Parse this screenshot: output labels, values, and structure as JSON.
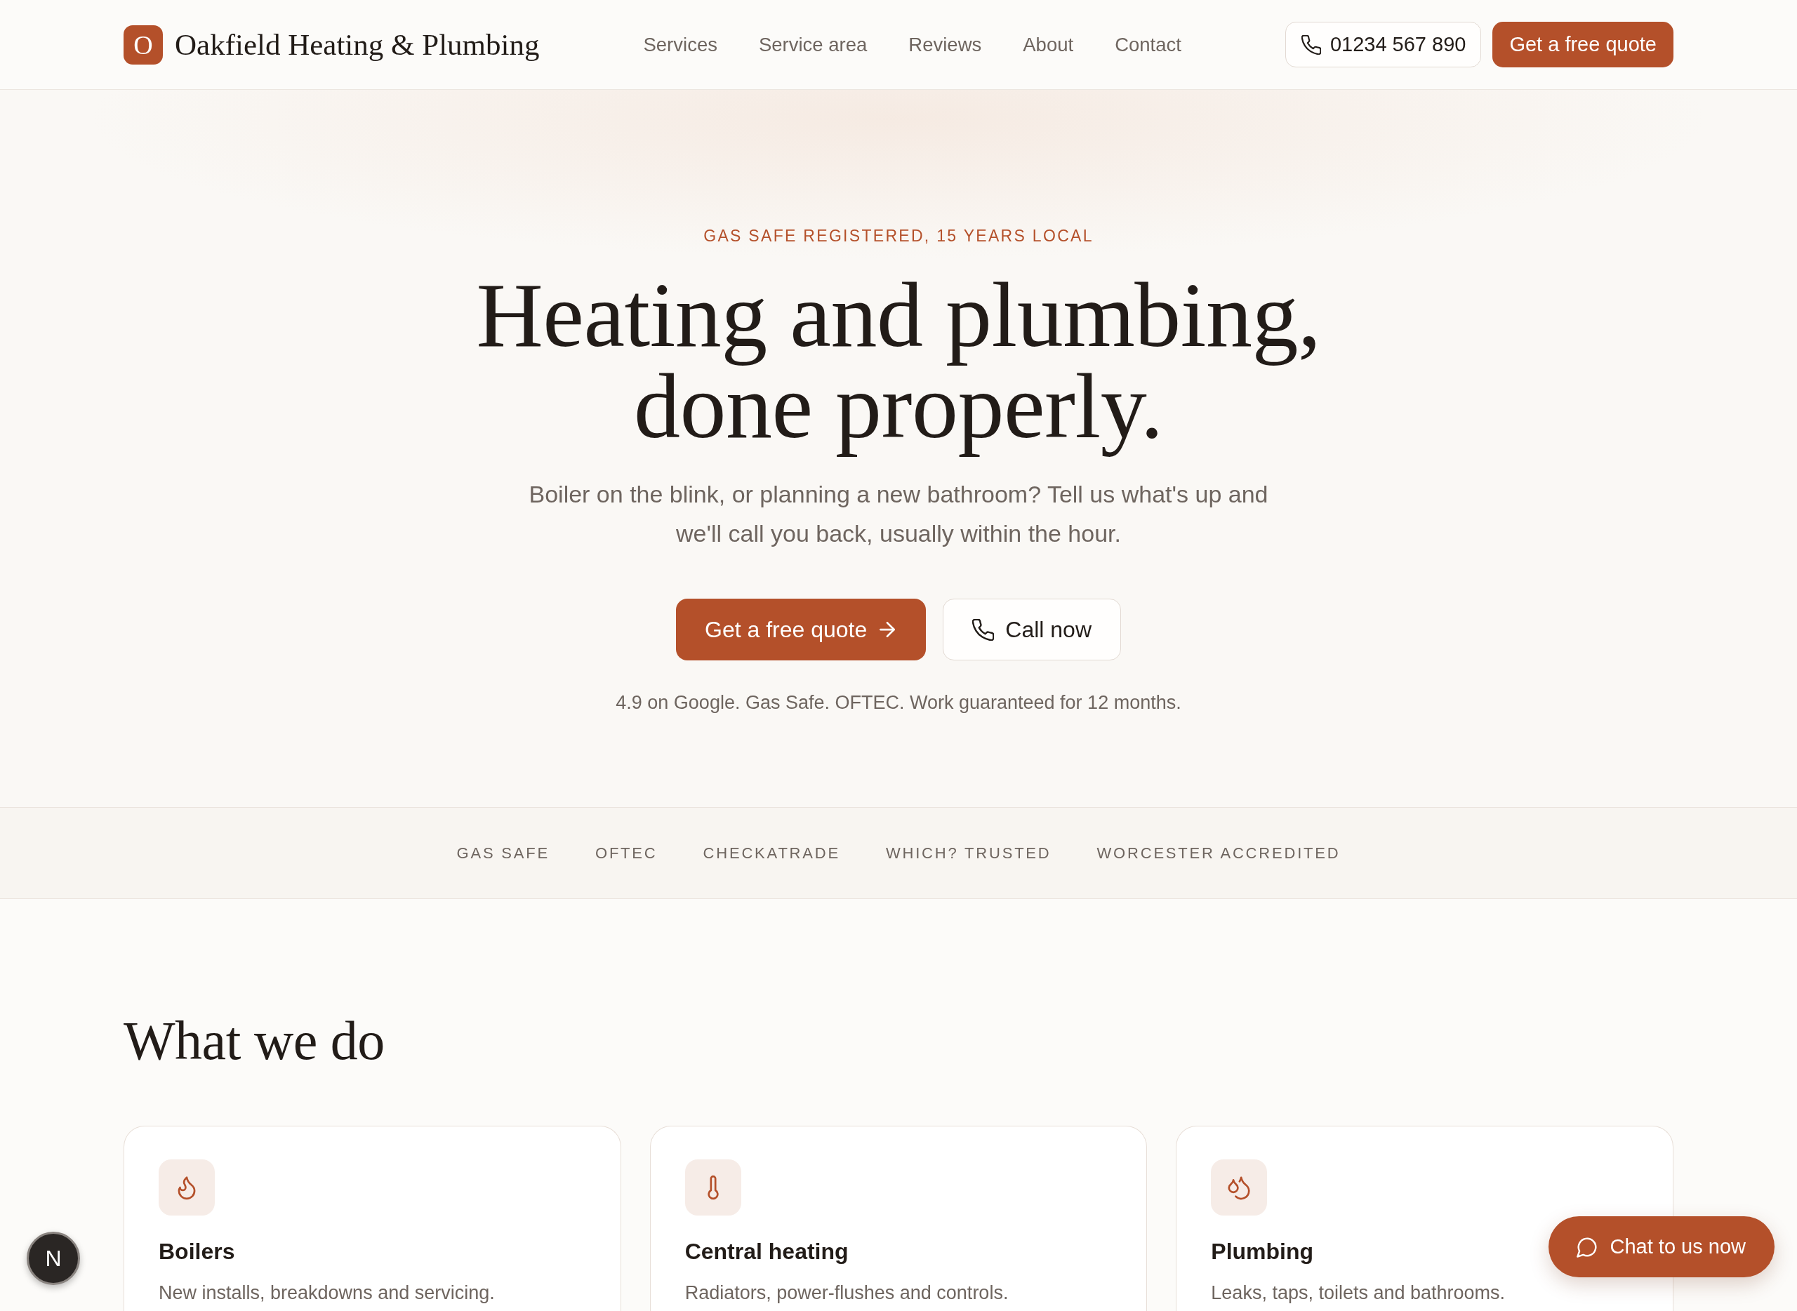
{
  "header": {
    "logo": {
      "mark": "O",
      "name": "Oakfield Heating & Plumbing"
    },
    "nav": [
      "Services",
      "Service area",
      "Reviews",
      "About",
      "Contact"
    ],
    "phone": "01234 567 890",
    "cta": "Get a free quote"
  },
  "hero": {
    "eyebrow": "GAS SAFE REGISTERED, 15 YEARS LOCAL",
    "title": "Heating and plumbing, done properly.",
    "subtitle": "Boiler on the blink, or planning a new bathroom? Tell us what's up and we'll call you back, usually within the hour.",
    "buttons": [
      {
        "kind": "primary",
        "label": "Get a free quote"
      },
      {
        "kind": "secondary",
        "label": "Call now"
      }
    ],
    "note": "4.9 on Google. Gas Safe. OFTEC. Work guaranteed for 12 months."
  },
  "accreditations": [
    "GAS SAFE",
    "OFTEC",
    "CHECKATRADE",
    "WHICH? TRUSTED",
    "WORCESTER ACCREDITED"
  ],
  "services": {
    "title": "What we do",
    "cards": [
      {
        "kind": "flame",
        "title": "Boilers",
        "description": "New installs, breakdowns and servicing."
      },
      {
        "kind": "thermometer",
        "title": "Central heating",
        "description": "Radiators, power-flushes and controls."
      },
      {
        "kind": "droplets",
        "title": "Plumbing",
        "description": "Leaks, taps, toilets and bathrooms."
      }
    ]
  },
  "chat_button": {
    "label": "Chat to us now"
  },
  "dev_badge": {
    "label": "N"
  }
}
